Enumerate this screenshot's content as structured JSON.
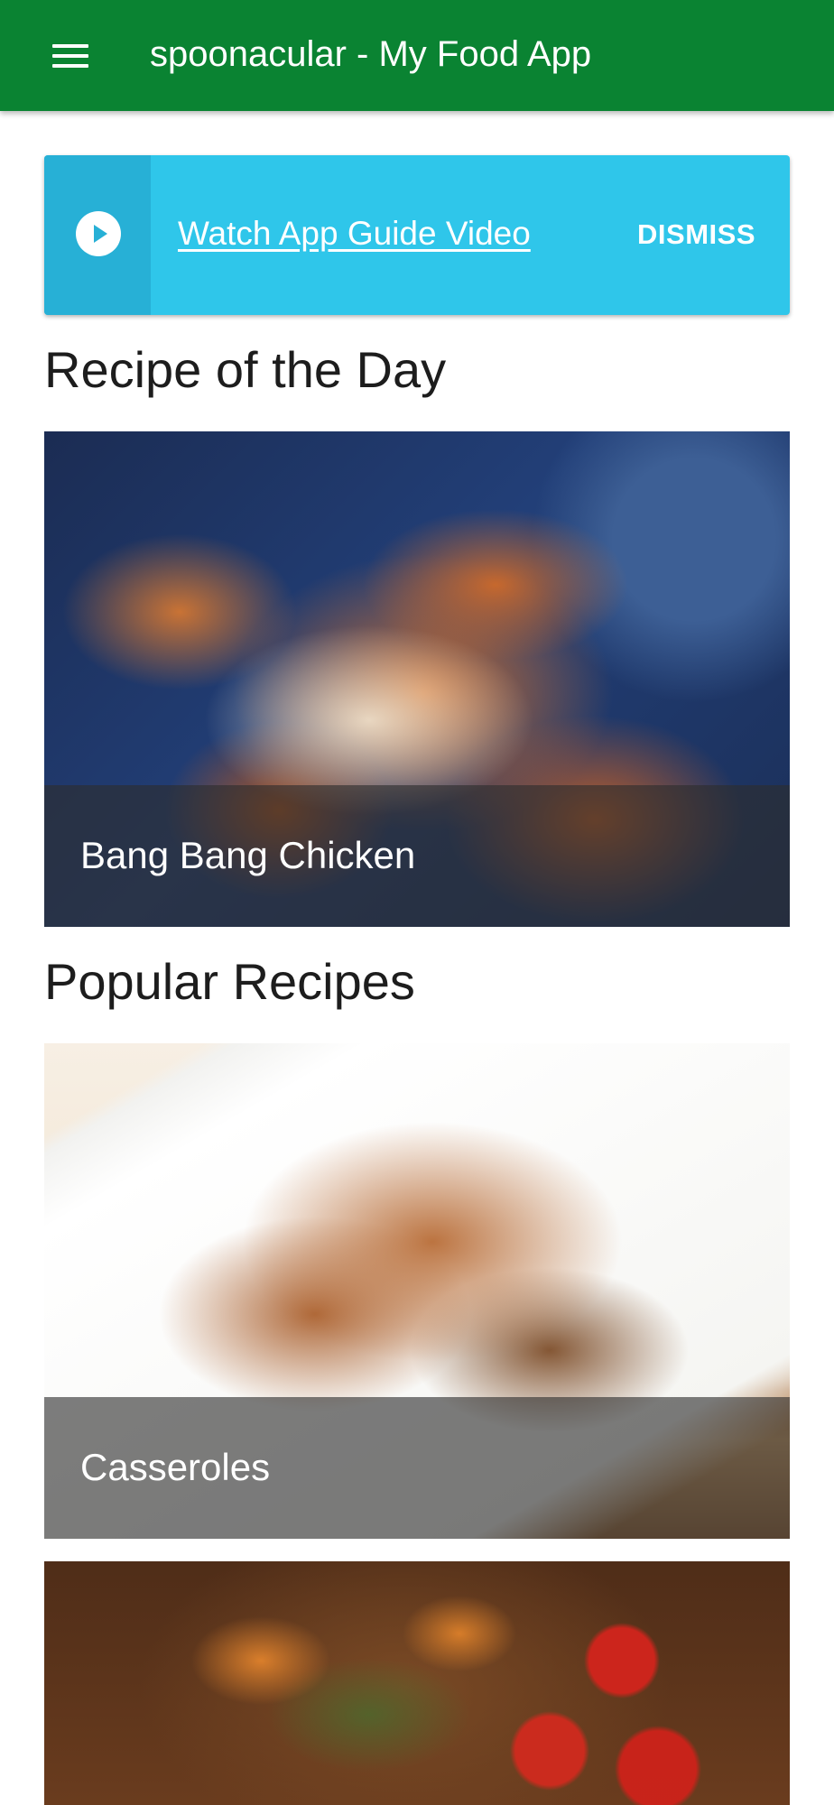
{
  "app_bar": {
    "title": "spoonacular - My Food App",
    "menu_icon": "menu-icon",
    "background_color": "#0a8332"
  },
  "guide_banner": {
    "link_text": "Watch App Guide Video",
    "dismiss_label": "DISMISS",
    "icon": "play-circle-icon",
    "background_color": "#2fc6ea"
  },
  "recipe_of_the_day": {
    "heading": "Recipe of the Day",
    "recipe": {
      "name": "Bang Bang Chicken"
    }
  },
  "popular_recipes": {
    "heading": "Popular Recipes",
    "items": [
      {
        "name": "Casseroles"
      },
      {
        "name": ""
      }
    ]
  }
}
